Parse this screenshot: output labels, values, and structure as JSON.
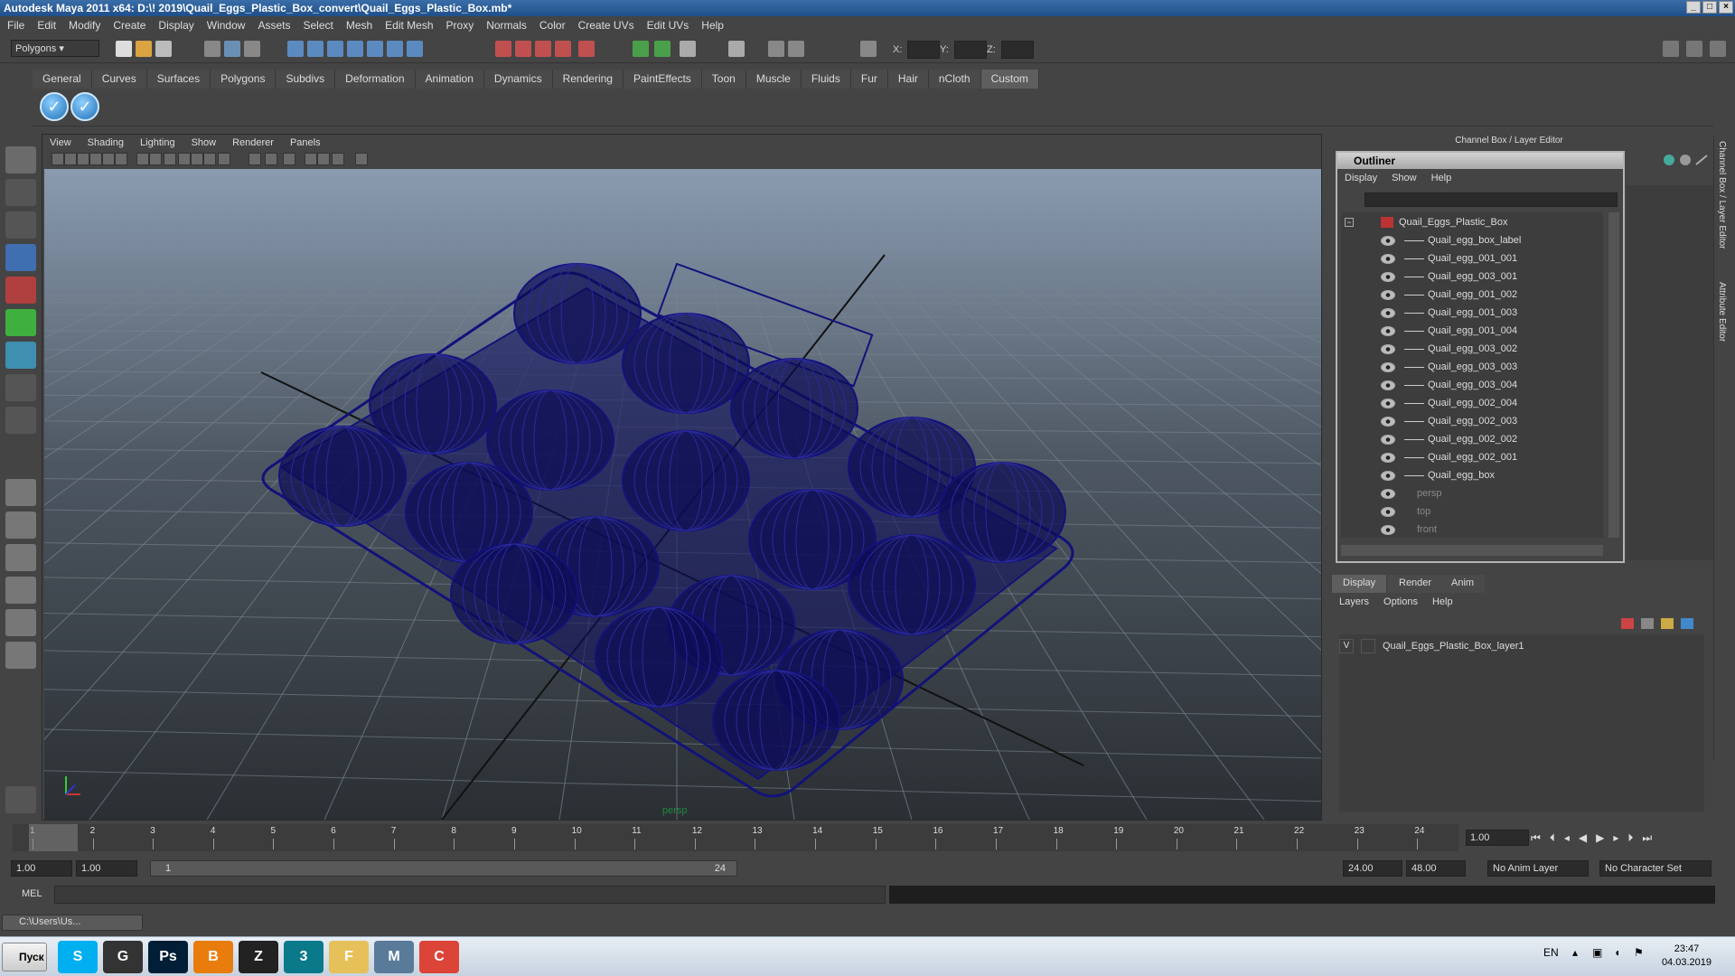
{
  "window": {
    "title": "Autodesk Maya 2011 x64: D:\\! 2019\\Quail_Eggs_Plastic_Box_convert\\Quail_Eggs_Plastic_Box.mb*"
  },
  "menubar": [
    "File",
    "Edit",
    "Modify",
    "Create",
    "Display",
    "Window",
    "Assets",
    "Select",
    "Mesh",
    "Edit Mesh",
    "Proxy",
    "Normals",
    "Color",
    "Create UVs",
    "Edit UVs",
    "Help"
  ],
  "statusline": {
    "mode": "Polygons",
    "x_label": "X:",
    "y_label": "Y:",
    "z_label": "Z:"
  },
  "shelf": {
    "tabs": [
      "General",
      "Curves",
      "Surfaces",
      "Polygons",
      "Subdivs",
      "Deformation",
      "Animation",
      "Dynamics",
      "Rendering",
      "PaintEffects",
      "Toon",
      "Muscle",
      "Fluids",
      "Fur",
      "Hair",
      "nCloth",
      "Custom"
    ],
    "active_tab": "Custom",
    "buttons": [
      "check-icon",
      "check-icon"
    ]
  },
  "viewport": {
    "menu": [
      "View",
      "Shading",
      "Lighting",
      "Show",
      "Renderer",
      "Panels"
    ],
    "camera_label": "persp",
    "wire_color": "#12127a"
  },
  "channelbox": {
    "title": "Channel Box / Layer Editor",
    "side_tabs": [
      "Channel Box / Layer Editor",
      "Attribute Editor"
    ]
  },
  "outliner": {
    "title": "Outliner",
    "menu": [
      "Display",
      "Show",
      "Help"
    ],
    "root": "Quail_Eggs_Plastic_Box",
    "children": [
      "Quail_egg_box_label",
      "Quail_egg_001_001",
      "Quail_egg_003_001",
      "Quail_egg_001_002",
      "Quail_egg_001_003",
      "Quail_egg_001_004",
      "Quail_egg_003_002",
      "Quail_egg_003_003",
      "Quail_egg_003_004",
      "Quail_egg_002_004",
      "Quail_egg_002_003",
      "Quail_egg_002_002",
      "Quail_egg_002_001",
      "Quail_egg_box"
    ],
    "cameras": [
      "persp",
      "top",
      "front"
    ]
  },
  "layers": {
    "tabs": [
      "Display",
      "Render",
      "Anim"
    ],
    "menu": [
      "Layers",
      "Options",
      "Help"
    ],
    "rows": [
      {
        "visible": "V",
        "name": "Quail_Eggs_Plastic_Box_layer1"
      }
    ]
  },
  "timeline": {
    "ticks": [
      "1",
      "2",
      "3",
      "4",
      "5",
      "6",
      "7",
      "8",
      "9",
      "10",
      "11",
      "12",
      "13",
      "14",
      "15",
      "16",
      "17",
      "18",
      "19",
      "20",
      "21",
      "22",
      "23",
      "24"
    ],
    "current_frame": "1.00"
  },
  "range": {
    "start": "1.00",
    "playback_start": "1.00",
    "slider_start": "1",
    "slider_end": "24",
    "playback_end": "24.00",
    "end": "48.00",
    "anim_layer": "No Anim Layer",
    "character_set": "No Character Set"
  },
  "mel": {
    "label": "MEL"
  },
  "helpline": {
    "minimized_window": "C:\\Users\\Us..."
  },
  "taskbar": {
    "start": "Пуск",
    "apps": [
      {
        "name": "skype-icon",
        "glyph": "S",
        "color": "#00aff0"
      },
      {
        "name": "steam-icon",
        "glyph": "G",
        "color": "#333"
      },
      {
        "name": "photoshop-icon",
        "glyph": "Ps",
        "color": "#001e36"
      },
      {
        "name": "blender-icon",
        "glyph": "B",
        "color": "#e87d0d"
      },
      {
        "name": "zbrush-icon",
        "glyph": "Z",
        "color": "#222"
      },
      {
        "name": "3dsmax-icon",
        "glyph": "3",
        "color": "#0a7a8a"
      },
      {
        "name": "explorer-icon",
        "glyph": "F",
        "color": "#e6c15a"
      },
      {
        "name": "maya-icon",
        "glyph": "M",
        "color": "#5a7a9a"
      },
      {
        "name": "chrome-icon",
        "glyph": "C",
        "color": "#db4437"
      }
    ],
    "lang": "EN",
    "time": "23:47",
    "date": "04.03.2019"
  }
}
